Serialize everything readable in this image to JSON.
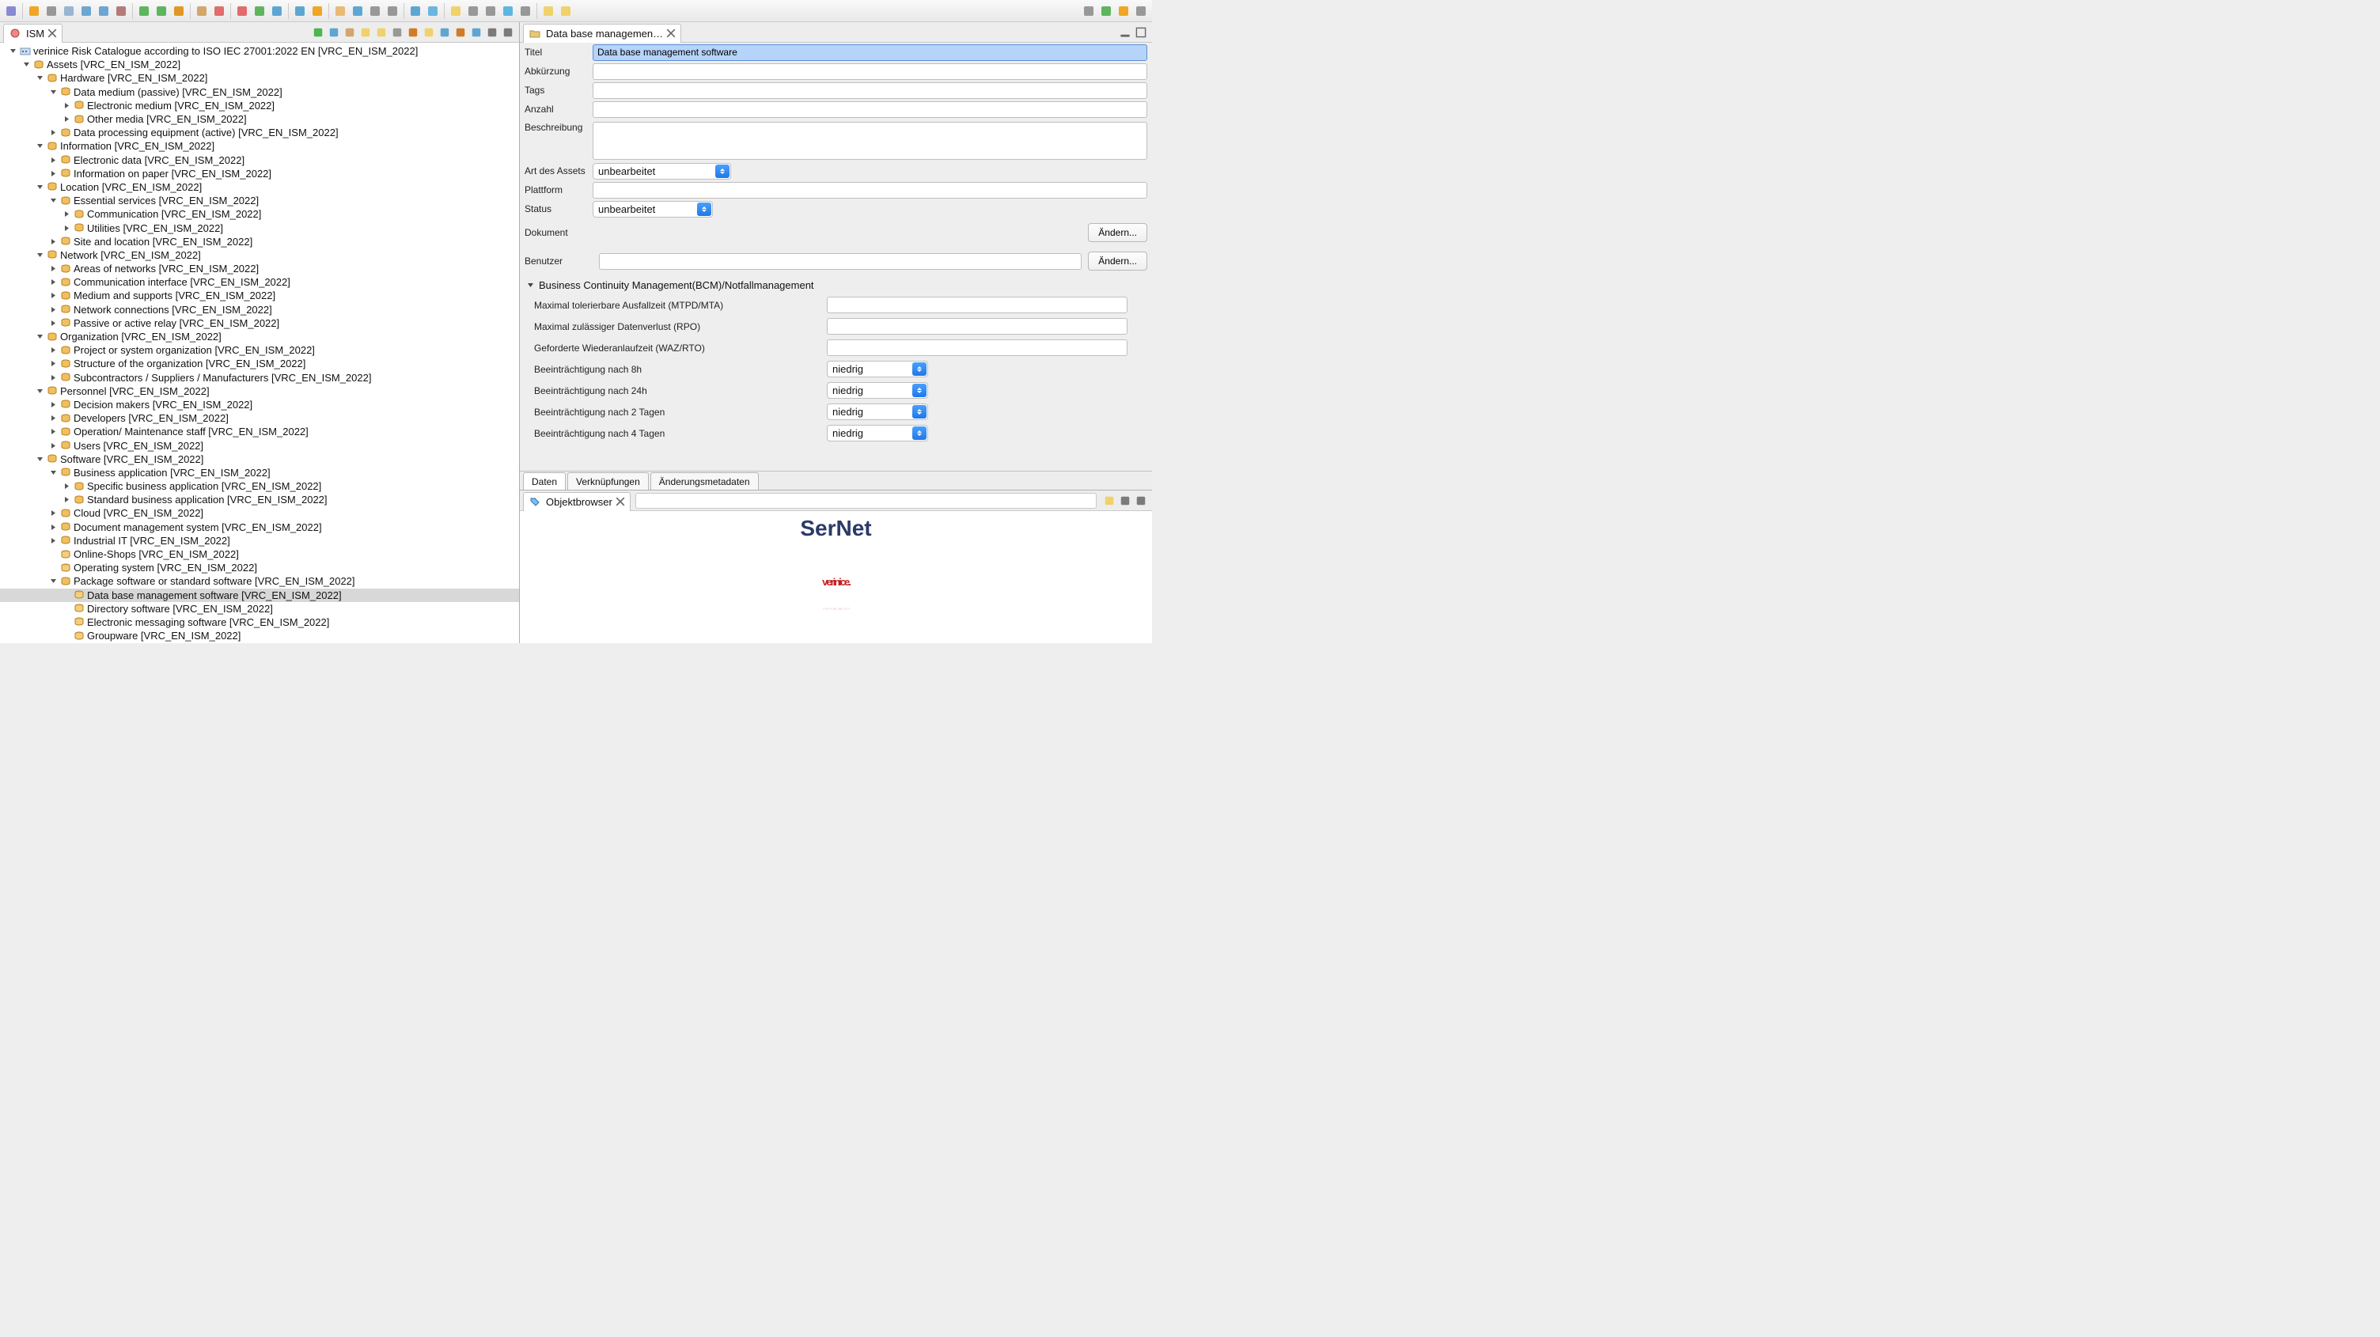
{
  "toolbar_icons": [
    "db",
    "doc",
    "printer",
    "copy",
    "save",
    "save2",
    "cut",
    "undo",
    "redo",
    "image",
    "paste",
    "gear",
    "gear2",
    "check",
    "book",
    "page",
    "stack",
    "folder",
    "book2",
    "user",
    "users",
    "export",
    "tag",
    "edit",
    "attach",
    "link",
    "world",
    "search",
    "back",
    "fwd"
  ],
  "toolbar_right_icons": [
    "maximize",
    "shield",
    "catalog",
    "user"
  ],
  "left_view": {
    "title": "ISM",
    "tabbar_icons": [
      "add",
      "new",
      "home",
      "back",
      "forward",
      "filter",
      "exec",
      "highlight",
      "chart1",
      "chart2",
      "page",
      "min",
      "max"
    ]
  },
  "tree": [
    {
      "d": 0,
      "e": 1,
      "i": "root",
      "t": "verinice Risk Catalogue according to ISO IEC 27001:2022 EN [VRC_EN_ISM_2022]"
    },
    {
      "d": 1,
      "e": 1,
      "i": "stack",
      "t": "Assets [VRC_EN_ISM_2022]"
    },
    {
      "d": 2,
      "e": 1,
      "i": "stack",
      "t": "Hardware [VRC_EN_ISM_2022]"
    },
    {
      "d": 3,
      "e": 1,
      "i": "stack",
      "t": "Data medium (passive) [VRC_EN_ISM_2022]"
    },
    {
      "d": 4,
      "e": 0,
      "i": "stack",
      "t": "Electronic medium [VRC_EN_ISM_2022]"
    },
    {
      "d": 4,
      "e": 0,
      "i": "stack",
      "t": "Other media [VRC_EN_ISM_2022]"
    },
    {
      "d": 3,
      "e": 0,
      "i": "stack",
      "t": "Data processing equipment (active) [VRC_EN_ISM_2022]"
    },
    {
      "d": 2,
      "e": 1,
      "i": "stack",
      "t": "Information [VRC_EN_ISM_2022]"
    },
    {
      "d": 3,
      "e": 0,
      "i": "stack",
      "t": "Electronic data [VRC_EN_ISM_2022]"
    },
    {
      "d": 3,
      "e": 0,
      "i": "stack",
      "t": "Information on paper [VRC_EN_ISM_2022]"
    },
    {
      "d": 2,
      "e": 1,
      "i": "stack",
      "t": "Location [VRC_EN_ISM_2022]"
    },
    {
      "d": 3,
      "e": 1,
      "i": "stack",
      "t": "Essential services [VRC_EN_ISM_2022]"
    },
    {
      "d": 4,
      "e": 0,
      "i": "stack",
      "t": "Communication [VRC_EN_ISM_2022]"
    },
    {
      "d": 4,
      "e": 0,
      "i": "stack",
      "t": "Utilities [VRC_EN_ISM_2022]"
    },
    {
      "d": 3,
      "e": 0,
      "i": "stack",
      "t": "Site and location [VRC_EN_ISM_2022]"
    },
    {
      "d": 2,
      "e": 1,
      "i": "stack",
      "t": "Network [VRC_EN_ISM_2022]"
    },
    {
      "d": 3,
      "e": 0,
      "i": "stack",
      "t": "Areas of networks [VRC_EN_ISM_2022]"
    },
    {
      "d": 3,
      "e": 0,
      "i": "stack",
      "t": "Communication interface [VRC_EN_ISM_2022]"
    },
    {
      "d": 3,
      "e": 0,
      "i": "stack",
      "t": "Medium and supports [VRC_EN_ISM_2022]"
    },
    {
      "d": 3,
      "e": 0,
      "i": "stack",
      "t": "Network connections [VRC_EN_ISM_2022]"
    },
    {
      "d": 3,
      "e": 0,
      "i": "stack",
      "t": "Passive or active relay [VRC_EN_ISM_2022]"
    },
    {
      "d": 2,
      "e": 1,
      "i": "stack",
      "t": "Organization [VRC_EN_ISM_2022]"
    },
    {
      "d": 3,
      "e": 0,
      "i": "stack",
      "t": "Project or system organization [VRC_EN_ISM_2022]"
    },
    {
      "d": 3,
      "e": 0,
      "i": "stack",
      "t": "Structure of the organization [VRC_EN_ISM_2022]"
    },
    {
      "d": 3,
      "e": 0,
      "i": "stack",
      "t": "Subcontractors / Suppliers / Manufacturers [VRC_EN_ISM_2022]"
    },
    {
      "d": 2,
      "e": 1,
      "i": "stack",
      "t": "Personnel [VRC_EN_ISM_2022]"
    },
    {
      "d": 3,
      "e": 0,
      "i": "stack",
      "t": "Decision makers [VRC_EN_ISM_2022]"
    },
    {
      "d": 3,
      "e": 0,
      "i": "stack",
      "t": "Developers [VRC_EN_ISM_2022]"
    },
    {
      "d": 3,
      "e": 0,
      "i": "stack",
      "t": "Operation/ Maintenance staff [VRC_EN_ISM_2022]"
    },
    {
      "d": 3,
      "e": 0,
      "i": "stack",
      "t": "Users [VRC_EN_ISM_2022]"
    },
    {
      "d": 2,
      "e": 1,
      "i": "stack",
      "t": "Software [VRC_EN_ISM_2022]"
    },
    {
      "d": 3,
      "e": 1,
      "i": "stack",
      "t": "Business application  [VRC_EN_ISM_2022]"
    },
    {
      "d": 4,
      "e": 0,
      "i": "stack",
      "t": "Specific business application  [VRC_EN_ISM_2022]"
    },
    {
      "d": 4,
      "e": 0,
      "i": "stack",
      "t": "Standard business application  [VRC_EN_ISM_2022]"
    },
    {
      "d": 3,
      "e": 0,
      "i": "stack",
      "t": "Cloud [VRC_EN_ISM_2022]"
    },
    {
      "d": 3,
      "e": 0,
      "i": "stack",
      "t": "Document management system [VRC_EN_ISM_2022]"
    },
    {
      "d": 3,
      "e": 0,
      "i": "stack",
      "t": "Industrial IT [VRC_EN_ISM_2022]"
    },
    {
      "d": 3,
      "e": -1,
      "i": "asset",
      "t": "Online-Shops [VRC_EN_ISM_2022]"
    },
    {
      "d": 3,
      "e": -1,
      "i": "asset",
      "t": "Operating system [VRC_EN_ISM_2022]"
    },
    {
      "d": 3,
      "e": 1,
      "i": "stack",
      "t": "Package software or standard software [VRC_EN_ISM_2022]"
    },
    {
      "d": 4,
      "e": -1,
      "i": "asset",
      "t": "Data base management software [VRC_EN_ISM_2022]",
      "sel": 1
    },
    {
      "d": 4,
      "e": -1,
      "i": "asset",
      "t": "Directory software [VRC_EN_ISM_2022]"
    },
    {
      "d": 4,
      "e": -1,
      "i": "asset",
      "t": "Electronic messaging software [VRC_EN_ISM_2022]"
    },
    {
      "d": 4,
      "e": -1,
      "i": "asset",
      "t": "Groupware [VRC_EN_ISM_2022]"
    }
  ],
  "editor": {
    "tab_title": "Data base managemen…",
    "fields": {
      "titel": {
        "label": "Titel",
        "value": "Data base management software"
      },
      "abk": {
        "label": "Abkürzung",
        "value": ""
      },
      "tags": {
        "label": "Tags",
        "value": ""
      },
      "anzahl": {
        "label": "Anzahl",
        "value": ""
      },
      "beschr": {
        "label": "Beschreibung",
        "value": ""
      },
      "art": {
        "label": "Art des Assets",
        "value": "unbearbeitet"
      },
      "plattform": {
        "label": "Plattform",
        "value": ""
      },
      "status": {
        "label": "Status",
        "value": "unbearbeitet"
      },
      "dokument": {
        "label": "Dokument"
      },
      "benutzer": {
        "label": "Benutzer",
        "value": ""
      }
    },
    "change_btn": "Ändern...",
    "section_bcm": "Business Continuity Management(BCM)/Notfallmanagement",
    "bcm": {
      "mtpd": {
        "label": "Maximal tolerierbare Ausfallzeit (MTPD/MTA)",
        "value": ""
      },
      "rpo": {
        "label": "Maximal zulässiger Datenverlust (RPO)",
        "value": ""
      },
      "rto": {
        "label": "Geforderte Wiederanlaufzeit (WAZ/RTO)",
        "value": ""
      },
      "b8": {
        "label": "Beeinträchtigung nach 8h",
        "value": "niedrig"
      },
      "b24": {
        "label": "Beeinträchtigung nach 24h",
        "value": "niedrig"
      },
      "b2d": {
        "label": "Beeinträchtigung nach 2 Tagen",
        "value": "niedrig"
      },
      "b4d": {
        "label": "Beeinträchtigung nach 4 Tagen",
        "value": "niedrig"
      }
    },
    "tabs": [
      "Daten",
      "Verknüpfungen",
      "Änderungsmetadaten"
    ],
    "active_tab": 0
  },
  "objbrowser": {
    "title": "Objektbrowser",
    "tabbar_icons": [
      "highlight",
      "min",
      "max"
    ],
    "logo": {
      "brand": "SerNet",
      "product": "verinice."
    }
  }
}
